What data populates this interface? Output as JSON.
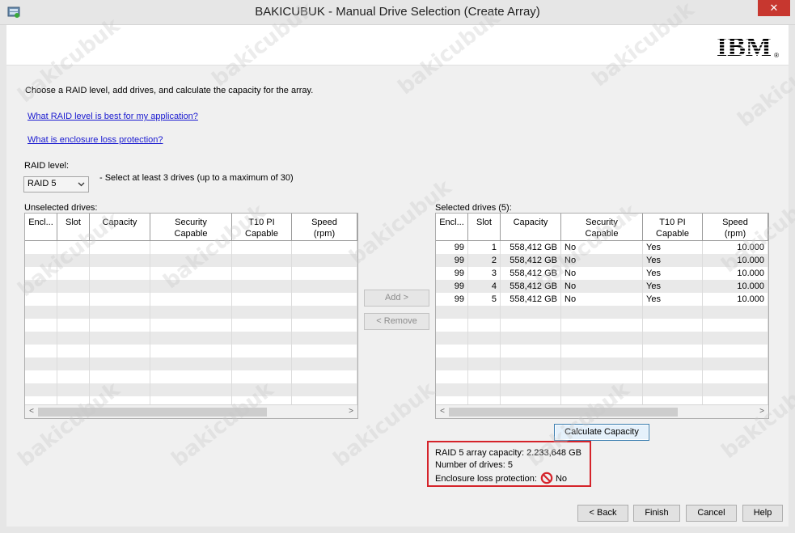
{
  "window": {
    "title": "BAKICUBUK - Manual Drive Selection (Create Array)",
    "close_label": "✕",
    "logo_text": "IBM"
  },
  "intro": {
    "text": "Choose a RAID level, add drives, and calculate the capacity for the array.",
    "link_raid": "What RAID level is best for my application?",
    "link_enclosure": "What is enclosure loss protection?"
  },
  "raid": {
    "label": "RAID level:",
    "selected": "RAID 5",
    "hint": "- Select at least 3 drives (up to a maximum of 30)"
  },
  "unselected": {
    "label": "Unselected drives:",
    "columns": [
      "Encl...",
      "Slot",
      "Capacity",
      "Security\nCapable",
      "T10 PI\nCapable",
      "Speed\n(rpm)"
    ],
    "rows": []
  },
  "selected": {
    "label": "Selected drives (5):",
    "columns": [
      "Encl...",
      "Slot",
      "Capacity",
      "Security\nCapable",
      "T10 PI\nCapable",
      "Speed\n(rpm)"
    ],
    "rows": [
      [
        "99",
        "1",
        "558,412 GB",
        "No",
        "Yes",
        "10.000"
      ],
      [
        "99",
        "2",
        "558,412 GB",
        "No",
        "Yes",
        "10.000"
      ],
      [
        "99",
        "3",
        "558,412 GB",
        "No",
        "Yes",
        "10.000"
      ],
      [
        "99",
        "4",
        "558,412 GB",
        "No",
        "Yes",
        "10.000"
      ],
      [
        "99",
        "5",
        "558,412 GB",
        "No",
        "Yes",
        "10.000"
      ]
    ]
  },
  "buttons": {
    "add": "Add >",
    "remove": "< Remove",
    "calculate": "Calculate Capacity",
    "back": "< Back",
    "finish": "Finish",
    "cancel": "Cancel",
    "help": "Help"
  },
  "result": {
    "capacity": "RAID 5 array capacity: 2.233,648 GB",
    "drives": "Number of drives: 5",
    "enclosure_label": "Enclosure loss protection:",
    "enclosure_value": "No"
  },
  "watermark_text": "bakicubuk",
  "colors": {
    "link": "#1a1ad0",
    "highlight_border": "#d5232a",
    "close_button": "#c7372f"
  }
}
